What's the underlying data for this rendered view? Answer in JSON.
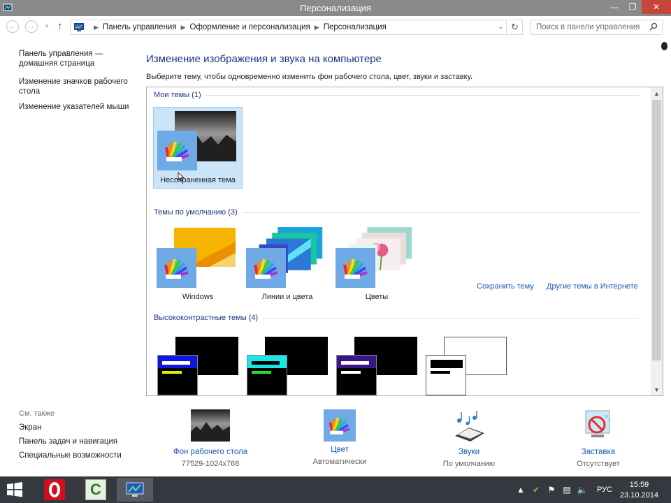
{
  "window": {
    "title": "Персонализация"
  },
  "addressbar": {
    "crumbs": [
      "Панель управления",
      "Оформление и персонализация",
      "Персонализация"
    ],
    "search_placeholder": "Поиск в панели управления"
  },
  "leftnav": {
    "items": [
      "Панель управления — домашняя страница",
      "Изменение значков рабочего стола",
      "Изменение указателей мыши"
    ]
  },
  "seealso": {
    "header": "См. также",
    "items": [
      "Экран",
      "Панель задач и навигация",
      "Специальные возможности"
    ]
  },
  "main": {
    "title": "Изменение изображения и звука на компьютере",
    "description": "Выберите тему, чтобы одновременно изменить фон рабочего стола, цвет, звуки и заставку.",
    "groups": {
      "my": {
        "header": "Мои темы (1)",
        "themes": [
          {
            "label": "Несохраненная тема",
            "selected": true
          }
        ]
      },
      "default": {
        "header": "Темы по умолчанию (3)",
        "themes": [
          {
            "label": "Windows"
          },
          {
            "label": "Линии и цвета"
          },
          {
            "label": "Цветы"
          }
        ]
      },
      "hc": {
        "header": "Высококонтрастные темы (4)"
      }
    },
    "save_theme": "Сохранить тему",
    "more_themes": "Другие темы в Интернете"
  },
  "bottom": {
    "items": [
      {
        "link": "Фон рабочего стола",
        "sub": "77529-1024x768"
      },
      {
        "link": "Цвет",
        "sub": "Автоматически"
      },
      {
        "link": "Звуки",
        "sub": "По умолчанию"
      },
      {
        "link": "Заставка",
        "sub": "Отсутствует"
      }
    ]
  },
  "taskbar": {
    "language": "РУС",
    "time": "15:59",
    "date": "23.10.2014"
  },
  "colors": {
    "titlebar": "#8a8a8a",
    "link": "#1b58b8",
    "heading": "#1e3287",
    "selection": "#cce4f7",
    "taskbar": "#35393f",
    "close": "#c7463b"
  }
}
